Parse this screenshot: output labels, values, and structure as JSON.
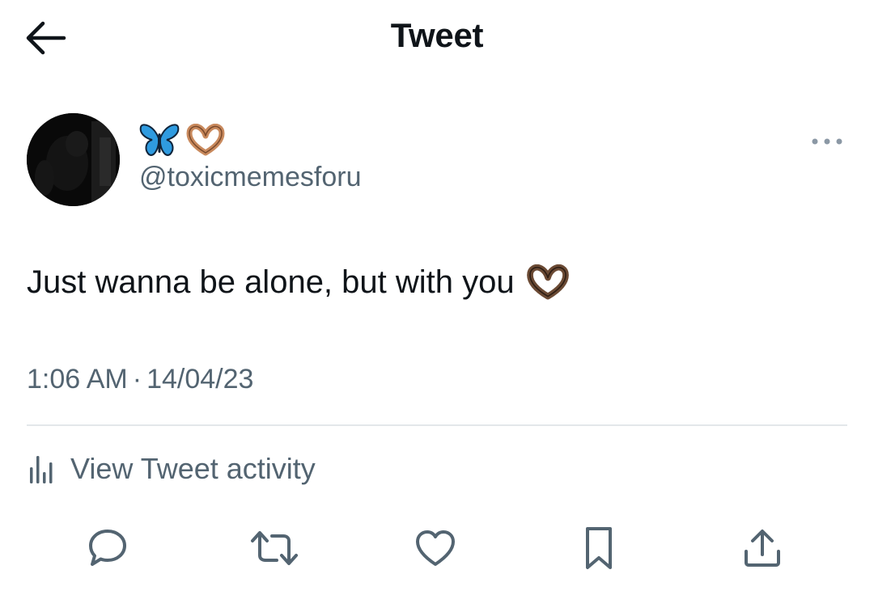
{
  "header": {
    "title": "Tweet",
    "back_icon": "arrow-left-icon"
  },
  "author": {
    "display_name_icons": [
      "butterfly-emoji-icon",
      "heart-hands-emoji-icon"
    ],
    "username": "@toxicmemesforu",
    "avatar": "avatar-dark-photo",
    "more_icon": "more-horizontal-icon"
  },
  "tweet": {
    "text": "Just wanna be alone, but with you",
    "text_emoji_icon": "heart-hands-dark-emoji-icon",
    "time": "1:06 AM",
    "separator": "·",
    "date": "14/04/23"
  },
  "activity": {
    "label": "View Tweet activity",
    "icon": "bar-chart-icon"
  },
  "actions": [
    {
      "name": "reply",
      "icon": "reply-bubble-icon"
    },
    {
      "name": "retweet",
      "icon": "retweet-icon"
    },
    {
      "name": "like",
      "icon": "heart-outline-icon"
    },
    {
      "name": "bookmark",
      "icon": "bookmark-icon"
    },
    {
      "name": "share",
      "icon": "share-upload-icon"
    }
  ],
  "colors": {
    "text_primary": "#0f1419",
    "text_secondary": "#536471",
    "divider": "#e3e7ea",
    "butterfly": "#2f9be0",
    "heart_hands_light": "#c98a5e",
    "heart_hands_dark": "#6b4a34"
  }
}
